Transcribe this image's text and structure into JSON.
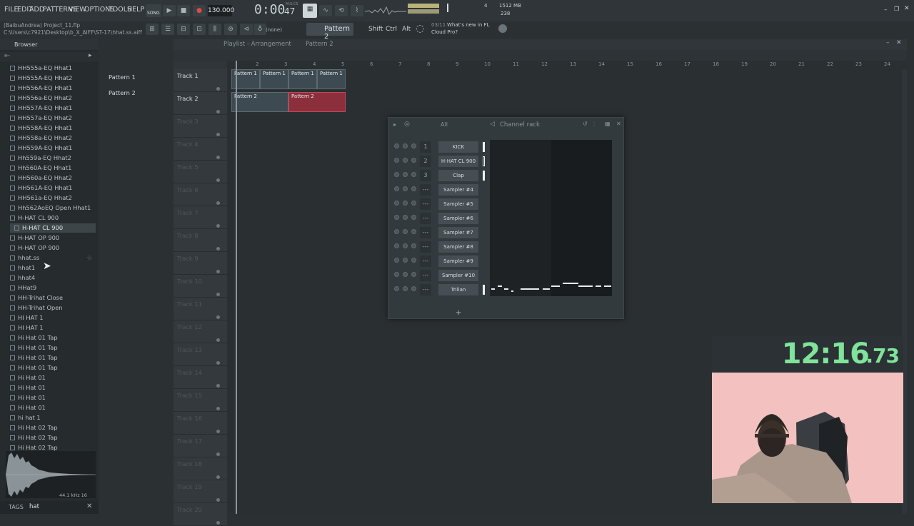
{
  "menu": [
    "FILE",
    "EDIT",
    "ADD",
    "PATTERNS",
    "VIEW",
    "OPTIONS",
    "TOOLS",
    "HELP"
  ],
  "transport": {
    "mode": "SONG",
    "tempo": "130.000",
    "time": "0:00",
    "time_small": "47",
    "time_label": "M:S:CS",
    "cpu": "4",
    "mem": "1512 MB",
    "mem2": "238"
  },
  "project": {
    "name": "(BaibuAndrea) Project_11.flp",
    "path": "C:\\Users\\c7921\\Desktop\\b_X_AIFF\\ST-17\\hhat.ss.aiff"
  },
  "toolbar2": {
    "pattern_selector": "(none)",
    "current_pattern": "Pattern 2",
    "modifiers": [
      "Shift",
      "Ctrl",
      "Alt"
    ],
    "news_date": "03/11",
    "news_text": "What's new in FL",
    "news_text2": "Cloud Pro?"
  },
  "browser": {
    "title": "Browser",
    "items": [
      "HH555a-EQ Hhat1",
      "HH555A-EQ Hhat2",
      "HH556A-EQ Hhat1",
      "HH556a-EQ Hhat2",
      "HH557A-EQ Hhat1",
      "HH557a-EQ Hhat2",
      "HH558A-EQ Hhat1",
      "HH558a-EQ Hhat2",
      "HH559A-EQ Hhat1",
      "Hh559a-EQ Hhat2",
      "Hh560A-EQ Hhat1",
      "HH560a-EQ Hhat2",
      "HH561A-EQ Hhat1",
      "HH561a-EQ Hhat2",
      "Hh562AoEQ Open Hhat1",
      "H-HAT CL 900",
      "H-HAT CL 900",
      "H-HAT OP 900",
      "H-HAT OP 900",
      "hhat.ss",
      "hhat1",
      "hhat4",
      "HHat9",
      "HH-Trihat Close",
      "HH-Trihat Open",
      "HI  HAT  1",
      "HI  HAT  1",
      "Hi Hat 01 Tap",
      "Hi Hat 01 Tap",
      "Hi Hat 01 Tap",
      "Hi Hat 01 Tap",
      "Hi Hat 01",
      "Hi Hat 01",
      "Hi Hat 01",
      "Hi Hat 01",
      "hi hat 1",
      "Hi Hat 02 Tap",
      "Hi Hat 02 Tap",
      "Hi Hat 02 Tap"
    ],
    "sample_info": "44.1 kHz 16",
    "tags_label": "TAGS",
    "search_value": "hat"
  },
  "patterns": [
    "Pattern 1",
    "Pattern 2"
  ],
  "playlist": {
    "title": "Playlist - Arrangement",
    "pattern": "Pattern 2",
    "ruler": [
      "2",
      "3",
      "4",
      "5",
      "6",
      "7",
      "8",
      "9",
      "10",
      "11",
      "12",
      "13",
      "14",
      "15",
      "16",
      "17",
      "18",
      "19",
      "20",
      "21",
      "22",
      "23",
      "24"
    ],
    "tracks": [
      "Track 1",
      "Track 2",
      "Track 3",
      "Track 4",
      "Track 5",
      "Track 6",
      "Track 7",
      "Track 8",
      "Track 9",
      "Track 10",
      "Track 11",
      "Track 12",
      "Track 13",
      "Track 14",
      "Track 15",
      "Track 16",
      "Track 17",
      "Track 18",
      "Track 19",
      "Track 20"
    ],
    "clips": [
      "Pattern 1",
      "Pattern 1",
      "Pattern 1",
      "Pattern 1",
      "Pattern 2",
      "Pattern 2"
    ]
  },
  "channel_rack": {
    "title": "Channel rack",
    "filter": "All",
    "channels": [
      {
        "num": "1",
        "name": "KICK"
      },
      {
        "num": "2",
        "name": "H-HAT CL 900"
      },
      {
        "num": "3",
        "name": "Clap"
      },
      {
        "num": "---",
        "name": "Sampler #4"
      },
      {
        "num": "---",
        "name": "Sampler #5"
      },
      {
        "num": "---",
        "name": "Sampler #6"
      },
      {
        "num": "---",
        "name": "Sampler #7"
      },
      {
        "num": "---",
        "name": "Sampler #8"
      },
      {
        "num": "---",
        "name": "Sampler #9"
      },
      {
        "num": "---",
        "name": "Sampler #10"
      },
      {
        "num": "---",
        "name": "Trilian"
      }
    ],
    "add_label": "+"
  },
  "overlay": {
    "timer": "12:16",
    "timer_small": ".73"
  }
}
